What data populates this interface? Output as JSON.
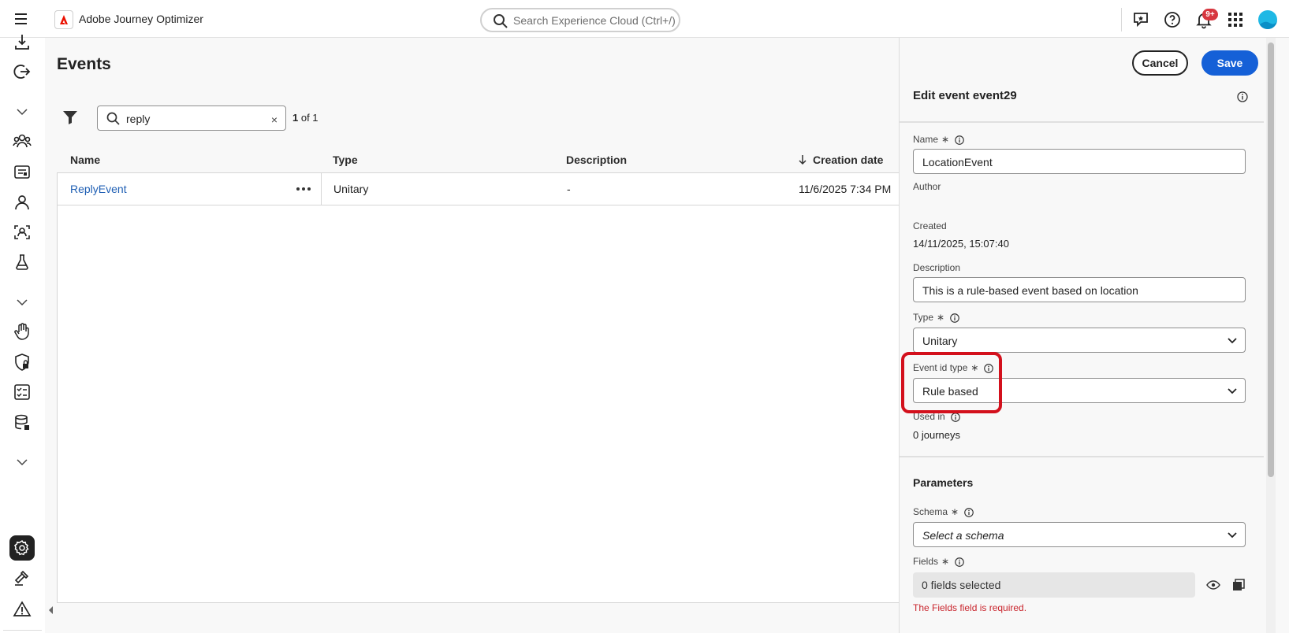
{
  "app": {
    "name": "Adobe Journey Optimizer"
  },
  "search": {
    "placeholder": "Search Experience Cloud (Ctrl+/)"
  },
  "notifications": {
    "badge": "9+"
  },
  "page": {
    "title": "Events"
  },
  "list_search": {
    "value": "reply",
    "clear": "×"
  },
  "count": {
    "current": "1",
    "rest": " of 1"
  },
  "table": {
    "columns": [
      "Name",
      "Type",
      "Description",
      "Creation date"
    ],
    "sort_column": "Creation date",
    "rows": [
      {
        "name": "ReplyEvent",
        "type": "Unitary",
        "description": "-",
        "created": "11/6/2025 7:34 PM"
      }
    ]
  },
  "panel": {
    "cancel": "Cancel",
    "save": "Save",
    "title": "Edit event event29",
    "name_label": "Name",
    "name_value": "LocationEvent",
    "author_label": "Author",
    "created_label": "Created",
    "created_value": "14/11/2025, 15:07:40",
    "description_label": "Description",
    "description_value": "This is a rule-based event based on location",
    "type_label": "Type",
    "type_value": "Unitary",
    "event_id_type_label": "Event id type",
    "event_id_type_value": "Rule based",
    "used_in_label": "Used in",
    "used_in_value": "0 journeys",
    "parameters_heading": "Parameters",
    "schema_label": "Schema",
    "schema_placeholder": "Select a schema",
    "fields_label": "Fields",
    "fields_value": "0 fields selected",
    "fields_error": "The Fields field is required.",
    "required_mark": "∗"
  },
  "colors": {
    "accent": "#1560d7",
    "link": "#1f5fb4",
    "error": "#c9252d",
    "highlight": "#d3101c"
  }
}
